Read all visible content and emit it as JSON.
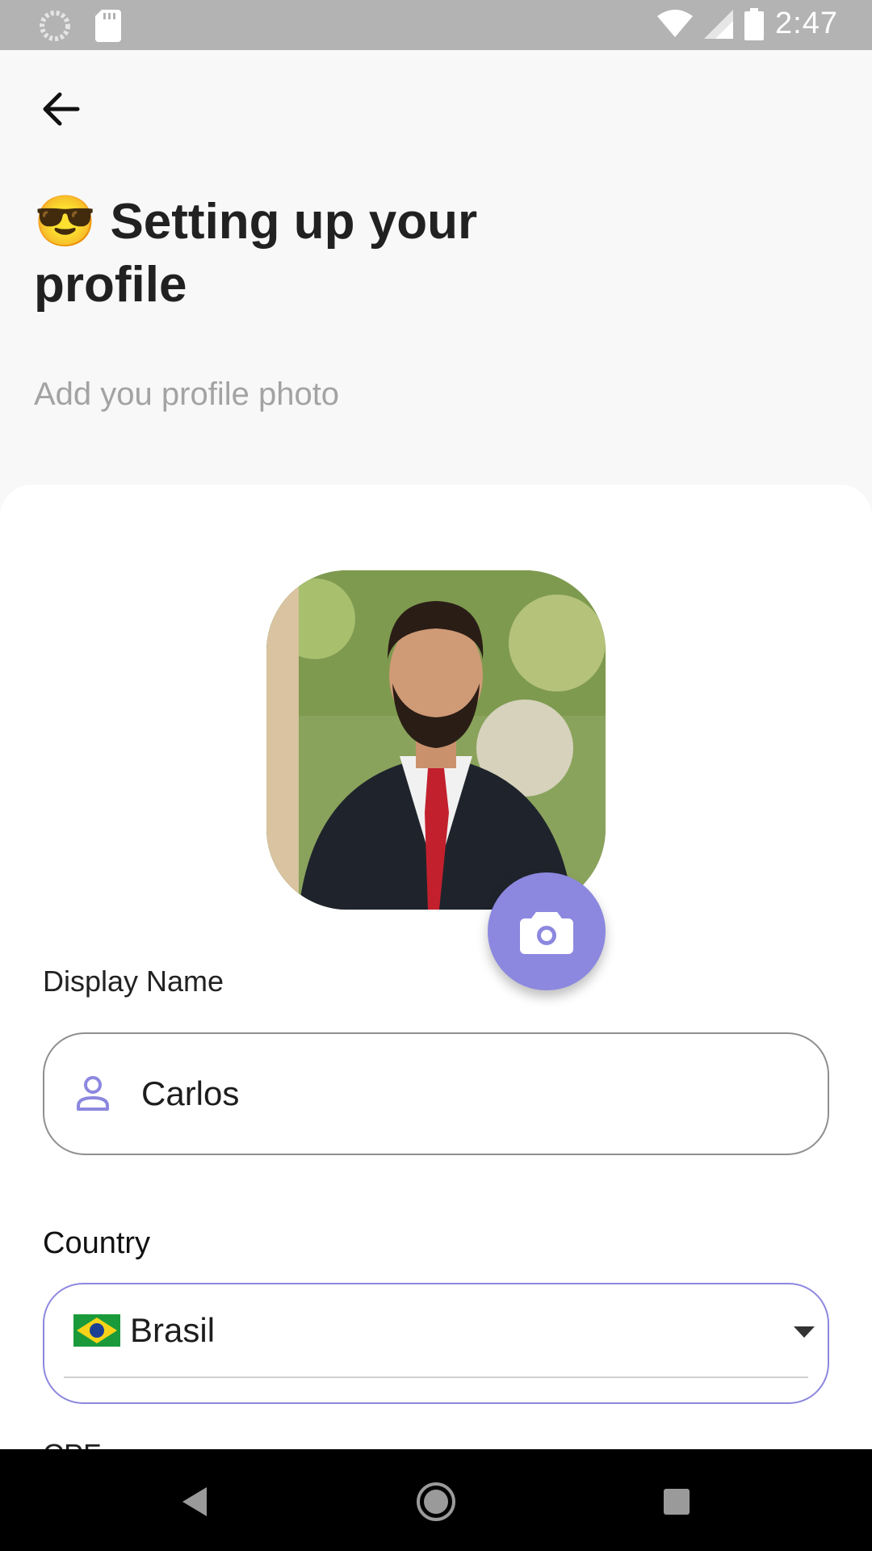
{
  "status_bar": {
    "time": "2:47"
  },
  "header": {
    "title_emoji": "😎",
    "title": "Setting up your profile",
    "subtitle": "Add you profile photo"
  },
  "form": {
    "display_name_label": "Display Name",
    "display_name_value": "Carlos",
    "country_label": "Country",
    "country_value": "Brasil",
    "next_label_partial": "CPF"
  },
  "colors": {
    "accent": "#8c88df",
    "background": "#f8f8f8",
    "card": "#ffffff",
    "status_bar": "#b3b3b3"
  },
  "icons": {
    "back": "arrow-back-icon",
    "camera": "camera-icon",
    "person": "person-icon",
    "dropdown": "dropdown-arrow-icon",
    "flag": "brazil-flag-icon"
  }
}
